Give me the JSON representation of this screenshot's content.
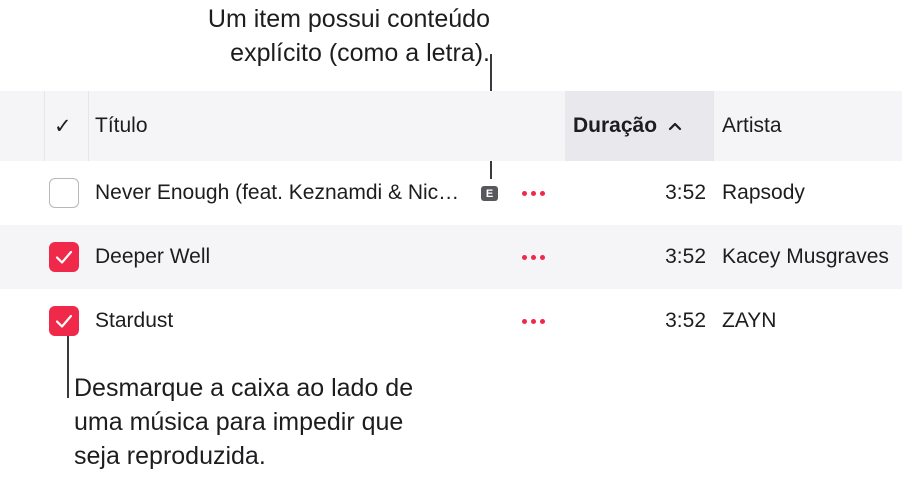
{
  "callouts": {
    "top_line1": "Um item possui conteúdo",
    "top_line2": "explícito (como a letra).",
    "bottom_line1": "Desmarque a caixa ao lado de",
    "bottom_line2": "uma música para impedir que",
    "bottom_line3": "seja reproduzida."
  },
  "table": {
    "headers": {
      "check": "✓",
      "title": "Título",
      "duration": "Duração",
      "duration_sort": "chevron-up-icon",
      "artist": "Artista"
    },
    "rows": [
      {
        "checked": false,
        "title": "Never Enough (feat. Keznamdi & Nic…",
        "explicit": "E",
        "duration": "3:52",
        "artist": "Rapsody"
      },
      {
        "checked": true,
        "title": "Deeper Well",
        "duration": "3:52",
        "artist": "Kacey Musgraves"
      },
      {
        "checked": true,
        "title": "Stardust",
        "duration": "3:52",
        "artist": "ZAYN"
      }
    ]
  },
  "colors": {
    "accent": "#f0284a",
    "header_bg": "#f5f5f7",
    "sorted_col_bg": "#e9e9ed",
    "badge": "#58585c"
  }
}
